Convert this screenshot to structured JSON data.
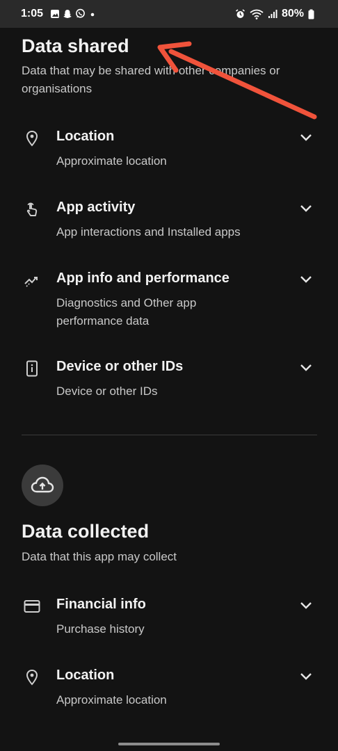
{
  "status_bar": {
    "time": "1:05",
    "battery": "80%",
    "icons_left": [
      "gallery-icon",
      "snapchat-icon",
      "whatsapp-icon",
      "dot-icon"
    ],
    "icons_right": [
      "alarm-icon",
      "wifi-icon",
      "signal-icon",
      "battery-icon"
    ]
  },
  "data_shared": {
    "title": "Data shared",
    "subtitle": "Data that may be shared with other companies or organisations",
    "items": [
      {
        "title": "Location",
        "subtitle": "Approximate location",
        "icon": "location-pin-icon"
      },
      {
        "title": "App activity",
        "subtitle": "App interactions and Installed apps",
        "icon": "touch-hand-icon"
      },
      {
        "title": "App info and performance",
        "subtitle": "Diagnostics and Other app performance data",
        "icon": "performance-trend-icon"
      },
      {
        "title": "Device or other IDs",
        "subtitle": "Device or other IDs",
        "icon": "device-id-icon"
      }
    ]
  },
  "data_collected": {
    "title": "Data collected",
    "subtitle": "Data that this app may collect",
    "icon": "cloud-upload-icon",
    "items": [
      {
        "title": "Financial info",
        "subtitle": "Purchase history",
        "icon": "credit-card-icon"
      },
      {
        "title": "Location",
        "subtitle": "Approximate location",
        "icon": "location-pin-icon"
      }
    ]
  },
  "colors": {
    "background": "#131313",
    "status_bar": "#2a2a2a",
    "annotation_arrow": "#f0533b"
  }
}
